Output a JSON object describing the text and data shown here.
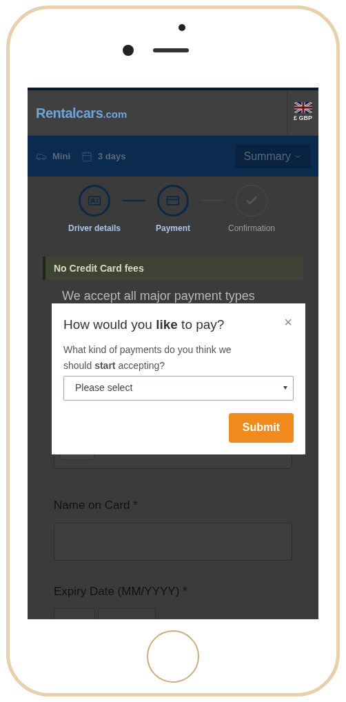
{
  "header": {
    "logo": {
      "brand": "Rentalcars",
      "suffix": ".com"
    },
    "currency": "£ GBP"
  },
  "trip_bar": {
    "items": [
      {
        "kind": "car",
        "label": "Mini"
      },
      {
        "kind": "calendar",
        "label": "3 days"
      }
    ],
    "summary_button": "Summary"
  },
  "steps": [
    {
      "kind": "driver",
      "label": "Driver details",
      "active": true
    },
    {
      "kind": "payment",
      "label": "Payment",
      "active": true
    },
    {
      "kind": "confirm",
      "label": "Confirmation",
      "active": false
    }
  ],
  "notice": "No Credit Card fees",
  "intro": "We accept all major payment types",
  "form": {
    "fields": [
      {
        "kind": "card"
      },
      {
        "kind": "text",
        "label": "Name on Card *"
      },
      {
        "kind": "split",
        "label": "Expiry Date (MM/YYYY) *"
      }
    ]
  },
  "modal": {
    "title": "How would you **like** to pay?",
    "close": "×",
    "question": "What kind of payments do you think we should **start** accepting?",
    "select": {
      "placeholder": "Please select"
    },
    "submit": "Submit"
  }
}
